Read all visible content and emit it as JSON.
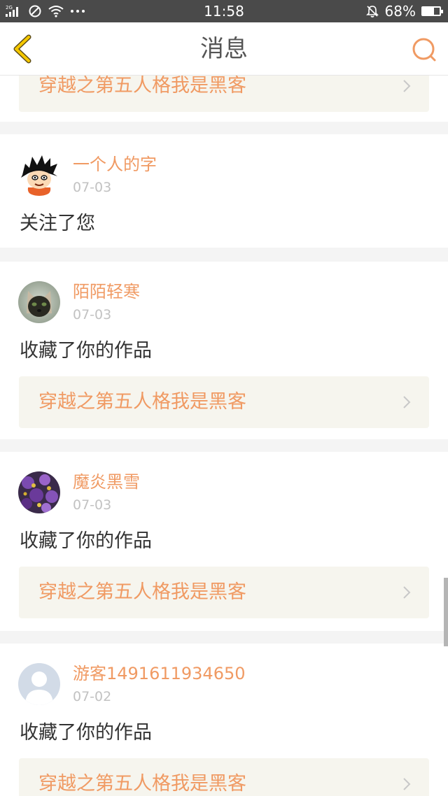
{
  "status_bar": {
    "network": "2G",
    "time": "11:58",
    "battery": "68%",
    "battery_level": 0.68
  },
  "nav": {
    "title": "消息",
    "back_icon": "chevron-left-icon",
    "search_icon": "search-icon"
  },
  "messages": [
    {
      "work_title": "穿越之第五人格我是黑客"
    },
    {
      "user": "一个人的字",
      "date": "07-03",
      "action": "关注了您",
      "avatar_icon": "cartoon-boy-avatar"
    },
    {
      "user": "陌陌轻寒",
      "date": "07-03",
      "action": "收藏了你的作品",
      "work_title": "穿越之第五人格我是黑客",
      "avatar_icon": "cat-avatar"
    },
    {
      "user": "魔炎黑雪",
      "date": "07-03",
      "action": "收藏了你的作品",
      "work_title": "穿越之第五人格我是黑客",
      "avatar_icon": "purple-flowers-avatar"
    },
    {
      "user": "游客1491611934650",
      "date": "07-02",
      "action": "收藏了你的作品",
      "work_title": "穿越之第五人格我是黑客",
      "avatar_icon": "default-user-avatar"
    }
  ],
  "colors": {
    "accent": "#f09a63",
    "back_icon": "#f5c800",
    "link_bg": "#f6f5ee",
    "page_bg": "#f4f4f4",
    "status_bar_bg": "#4a4a4a"
  }
}
